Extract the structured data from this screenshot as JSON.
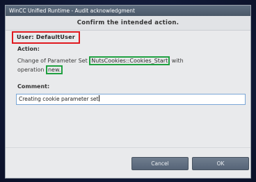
{
  "window": {
    "title": "WinCC Unified Runtime - Audit acknowledgment"
  },
  "dialog": {
    "header": "Confirm the intended action.",
    "user_label": "User:",
    "user_name": "DefaultUser",
    "action_label": "Action:",
    "action_text_1": "Change of Parameter Set ",
    "action_param_set": "NutsCookies::Cookies_Start",
    "action_text_2": " with",
    "action_text_3": "operation ",
    "action_operation": "new.",
    "comment_label": "Comment:",
    "comment_value": "Creating cookie parameter set"
  },
  "buttons": {
    "cancel": "Cancel",
    "ok": "OK"
  },
  "colors": {
    "user_highlight": "#e0181e",
    "parameter_highlight": "#1fa040",
    "titlebar": "#4f5d6e",
    "button": "#5f6d80"
  }
}
